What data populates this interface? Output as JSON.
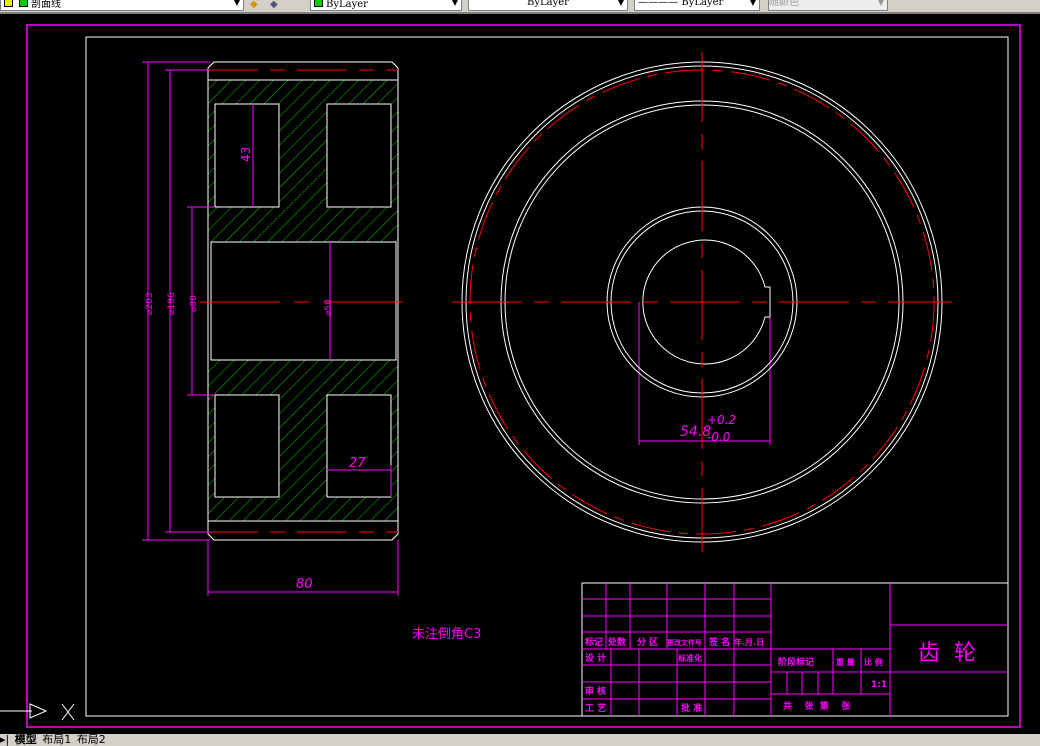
{
  "toolbar": {
    "layer": "剖面线",
    "color": "ByLayer",
    "linetype": "ByLayer",
    "lineweight": "ByLayer",
    "plotstyle": "随颜色"
  },
  "tabs": {
    "model": "模型",
    "layout1": "布局1",
    "layout2": "布局2"
  },
  "drawing": {
    "dims": {
      "d_outer": "⌀203",
      "d_root": "⌀196",
      "d_hub": "⌀80",
      "d_bore": "⌀50",
      "web_h": "43",
      "slot_w": "27",
      "width": "80",
      "key": "54.8",
      "tol_up": "+0.2",
      "tol_low": "-0.0"
    },
    "note": "未注倒角C3",
    "title_block": {
      "biaoji": "标记",
      "chushu": "处数",
      "fenqu": "分 区",
      "gengai": "更改文件号",
      "qianming": "签 名",
      "nianyueri": "年.月.日",
      "sheji": "设 计",
      "biaozhunhua": "标准化",
      "jieduan": "阶段标记",
      "zhongliang": "重 量",
      "bili": "比 例",
      "scale": "1:1",
      "shenhe": "审 核",
      "gongyi": "工 艺",
      "pizhun": "批 准",
      "sheets": "共    张  第    张",
      "part_name": "齿  轮"
    }
  }
}
